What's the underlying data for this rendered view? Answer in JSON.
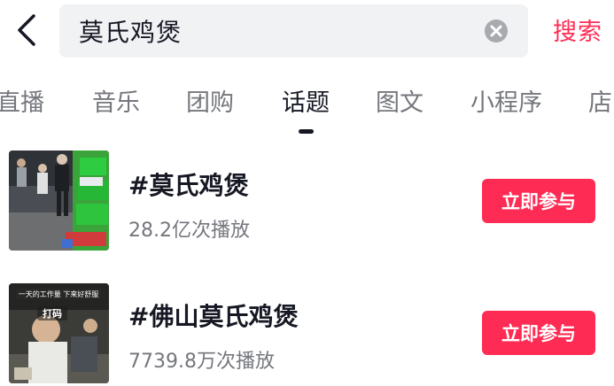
{
  "search": {
    "query": "莫氏鸡煲",
    "button_label": "搜索"
  },
  "tabs": [
    {
      "label": "直播"
    },
    {
      "label": "音乐"
    },
    {
      "label": "团购"
    },
    {
      "label": "话题",
      "active": true
    },
    {
      "label": "图文"
    },
    {
      "label": "小程序"
    },
    {
      "label": "店"
    }
  ],
  "results": [
    {
      "title": "#莫氏鸡煲",
      "plays": "28.2亿次播放",
      "button": "立即参与"
    },
    {
      "title": "#佛山莫氏鸡煲",
      "plays": "7739.8万次播放",
      "button": "立即参与",
      "thumb_texts": {
        "top": "一天的工作量 下来好舒服",
        "badge": "打码"
      }
    }
  ],
  "colors": {
    "accent": "#fe2c55",
    "text_primary": "#161823",
    "text_secondary": "#75777d",
    "search_bg": "#f1f2f4"
  }
}
